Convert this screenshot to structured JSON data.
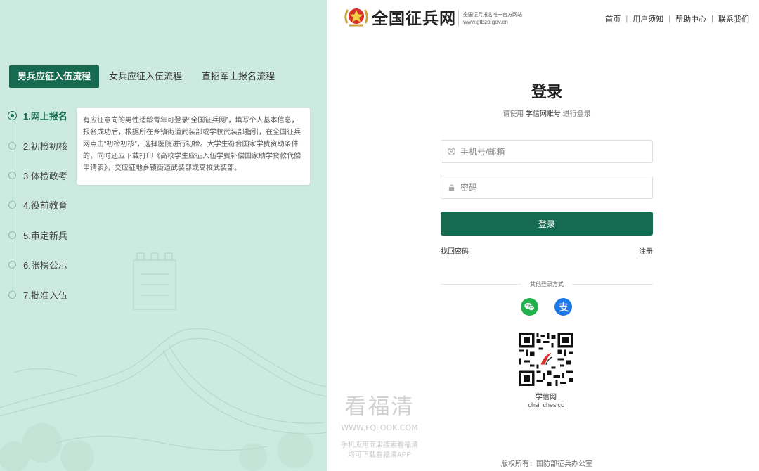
{
  "header": {
    "site_title": "全国征兵网",
    "tagline": "全国征兵报名唯一官方网站",
    "url": "www.gfbzb.gov.cn",
    "nav": [
      "首页",
      "用户须知",
      "帮助中心",
      "联系我们"
    ]
  },
  "process_tabs": {
    "active": "男兵应征入伍流程",
    "others": [
      "女兵应征入伍流程",
      "直招军士报名流程"
    ]
  },
  "steps": [
    {
      "label": "1.网上报名"
    },
    {
      "label": "2.初检初核"
    },
    {
      "label": "3.体检政考"
    },
    {
      "label": "4.役前教育"
    },
    {
      "label": "5.审定新兵"
    },
    {
      "label": "6.张榜公示"
    },
    {
      "label": "7.批准入伍"
    }
  ],
  "step_tip": "有应征意向的男性适龄青年可登录“全国征兵网”，填写个人基本信息，报名成功后，根据所在乡镇街道武装部或学校武装部指引，在全国征兵网点击“初检初核”，选择医院进行初检。大学生符合国家学费资助条件的，同时还应下载打印《高校学生应征入伍学费补偿国家助学贷款代偿申请表》，交应征地乡镇街道武装部或高校武装部。",
  "login": {
    "title": "登录",
    "subtitle_prefix": "请使用",
    "subtitle_account": "学信网账号",
    "subtitle_suffix": "进行登录",
    "username_placeholder": "手机号/邮箱",
    "password_placeholder": "密码",
    "submit_label": "登录",
    "forgot_label": "找回密码",
    "register_label": "注册",
    "other_methods_label": "其他登录方式",
    "qr_name": "学信网",
    "qr_id": "chsi_chesicc"
  },
  "social_icons": [
    "wechat-icon",
    "alipay-icon"
  ],
  "copyright": "版权所有：国防部征兵办公室",
  "watermark": {
    "brand": "看福清",
    "site": "WWW.FQLOOK.COM",
    "line1": "手机应用商店搜索看福清",
    "line2": "均可下载看福清APP"
  },
  "colors": {
    "primary": "#156a4f",
    "left_bg": "#cdeae0",
    "wechat": "#22b14c",
    "alipay": "#1e79e6"
  }
}
